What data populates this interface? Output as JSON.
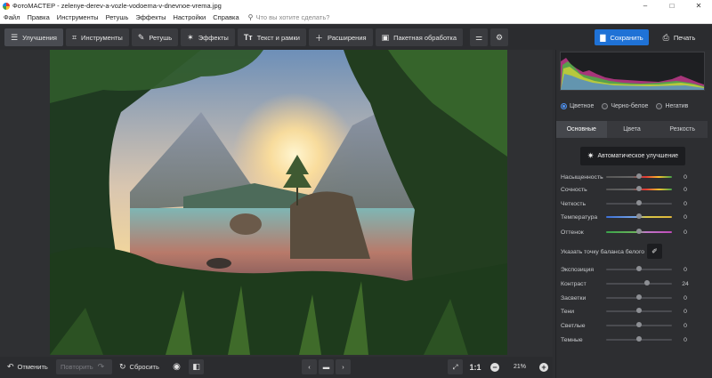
{
  "window": {
    "title": "ФотоМАСТЕР - zelenye-derev-a-vozle-vodoema-v-dnevnoe-vrema.jpg",
    "controls": [
      "–",
      "□",
      "✕"
    ]
  },
  "menu": {
    "items": [
      "Файл",
      "Правка",
      "Инструменты",
      "Ретушь",
      "Эффекты",
      "Настройки",
      "Справка"
    ],
    "search_placeholder": "Что вы хотите сделать?"
  },
  "toolbar": {
    "tabs": [
      {
        "label": "Улучшения",
        "icon": "sliders-icon"
      },
      {
        "label": "Инструменты",
        "icon": "crop-icon"
      },
      {
        "label": "Ретушь",
        "icon": "brush-icon"
      },
      {
        "label": "Эффекты",
        "icon": "magic-wand-icon"
      },
      {
        "label": "Текст и рамки",
        "icon": "text-icon"
      },
      {
        "label": "Расширения",
        "icon": "plus-icon"
      },
      {
        "label": "Пакетная обработка",
        "icon": "batch-icon"
      }
    ],
    "active_tab": 0,
    "save_label": "Сохранить",
    "print_label": "Печать"
  },
  "bottom": {
    "undo_label": "Отменить",
    "redo_label": "Повторить",
    "reset_label": "Сбросить",
    "zoom_ratio": "1:1",
    "zoom_percent": "21%"
  },
  "panel": {
    "modes": [
      "Цветное",
      "Черно-белое",
      "Негатив"
    ],
    "selected_mode": 0,
    "tabs": [
      "Основные",
      "Цвета",
      "Резкость"
    ],
    "active_tab": 0,
    "auto_button": "Автоматическое улучшение",
    "white_balance_label": "Указать точку баланса белого",
    "sliders_top": [
      {
        "label": "Насыщенность",
        "value": "0",
        "pos": 0.5,
        "grad": "linear-gradient(90deg,#555 0%,#666 40%,#e53935 60%,#fbc02d 80%,#43a047 100%)"
      },
      {
        "label": "Сочность",
        "value": "0",
        "pos": 0.5,
        "grad": "linear-gradient(90deg,#555 0%,#666 40%,#e53935 60%,#fbc02d 80%,#43a047 100%)"
      },
      {
        "label": "Четкость",
        "value": "0",
        "pos": 0.5,
        "grad": "linear-gradient(90deg,#4a4b50,#4a4b50)"
      },
      {
        "label": "Температура",
        "value": "0",
        "pos": 0.5,
        "grad": "linear-gradient(90deg,#3b6fd6,#7aa8e8 45%,#d8c74a 60%,#e0b83a)"
      },
      {
        "label": "Оттенок",
        "value": "0",
        "pos": 0.5,
        "grad": "linear-gradient(90deg,#3aa34a,#6bb35c 45%,#c07ac8 60%,#c04ab8)"
      }
    ],
    "sliders_bottom": [
      {
        "label": "Экспозиция",
        "value": "0",
        "pos": 0.5
      },
      {
        "label": "Контраст",
        "value": "24",
        "pos": 0.62
      },
      {
        "label": "Засветки",
        "value": "0",
        "pos": 0.5
      },
      {
        "label": "Тени",
        "value": "0",
        "pos": 0.5
      },
      {
        "label": "Светлые",
        "value": "0",
        "pos": 0.5
      },
      {
        "label": "Темные",
        "value": "0",
        "pos": 0.5
      }
    ]
  }
}
